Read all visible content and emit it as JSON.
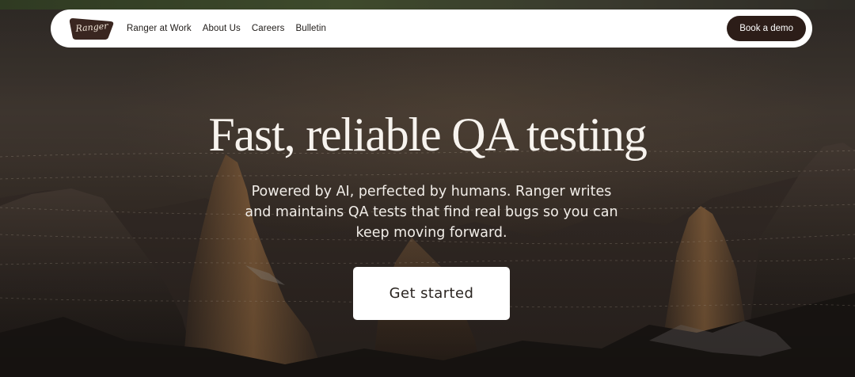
{
  "brand": {
    "logo_text": "Ranger"
  },
  "nav": {
    "links": [
      "Ranger at Work",
      "About Us",
      "Careers",
      "Bulletin"
    ],
    "cta_label": "Book a demo"
  },
  "hero": {
    "title": "Fast, reliable QA testing",
    "subtitle_lines": [
      "Powered by AI, perfected by humans. Ranger writes",
      "and maintains QA tests that find real bugs so you can",
      "keep moving forward."
    ],
    "cta_label": "Get started"
  },
  "colors": {
    "nav_bg": "#ffffff",
    "demo_button_bg": "#2c1d18",
    "logo_bg": "#3a2620",
    "hero_text": "#f7f3ee"
  }
}
